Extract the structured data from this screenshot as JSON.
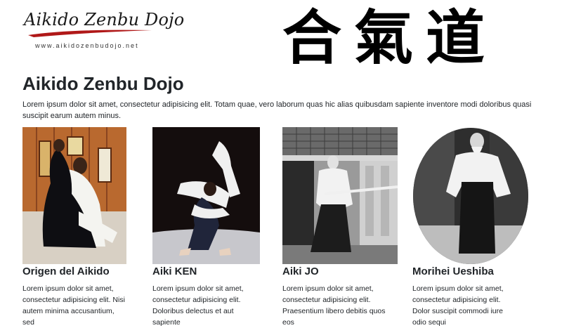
{
  "header": {
    "logo_title": "Aikido Zenbu Dojo",
    "logo_url": "www.aikidozenbudojo.net",
    "kanji": "合氣道",
    "accent_color": "#b01818"
  },
  "main": {
    "title": "Aikido Zenbu Dojo",
    "intro": "Lorem ipsum dolor sit amet, consectetur adipisicing elit. Totam quae, vero laborum quas hic alias quibusdam sapiente inventore modi doloribus quasi suscipit earum autem minus."
  },
  "cards": [
    {
      "title": "Origen del Aikido",
      "text": "Lorem ipsum dolor sit amet, consectetur adipisicing elit. Nisi autem minima accusantium, sed",
      "image": "aikido-throw-photo"
    },
    {
      "title": "Aiki KEN",
      "text": "Lorem ipsum dolor sit amet, consectetur adipisicing elit. Doloribus delectus et aut sapiente",
      "image": "aikido-flip-photo"
    },
    {
      "title": "Aiki JO",
      "text": "Lorem ipsum dolor sit amet, consectetur adipisicing elit. Praesentium libero debitis quos eos",
      "image": "jo-staff-photo"
    },
    {
      "title": "Morihei Ueshiba",
      "text": "Lorem ipsum dolor sit amet, consectetur adipisicing elit. Dolor suscipit commodi iure odio sequi",
      "image": "founder-portrait-photo"
    }
  ]
}
